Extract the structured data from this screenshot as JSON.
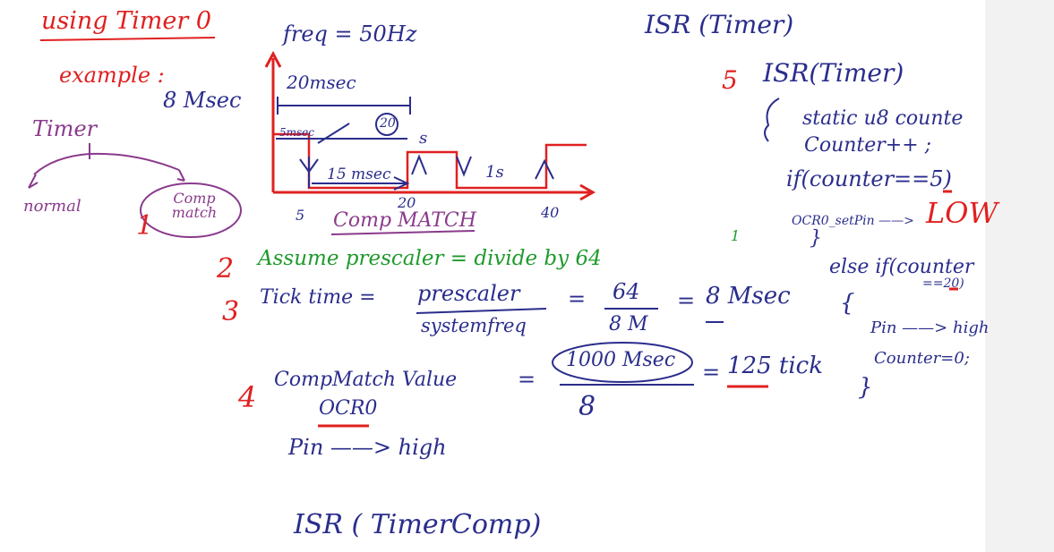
{
  "colors": {
    "red": "#e02020",
    "blue": "#2a2d8c",
    "purple": "#8a3a8c",
    "green": "#1f9a2c"
  },
  "left": {
    "title": "using Timer 0",
    "example": "example :",
    "msec": "8 Msec",
    "timer": "Timer",
    "normal": "normal",
    "comp_match": "Comp match",
    "num1": "1"
  },
  "diagram": {
    "freq": "freq = 50Hz",
    "period": "20msec",
    "low": "5msec",
    "high": "15 msec",
    "circled": "20",
    "s_label": "s",
    "one_s": "1s",
    "tick5": "5",
    "tick20": "20",
    "tick40": "40",
    "comp_match": "Comp MATCH"
  },
  "steps": {
    "n2": "2",
    "assume": "Assume prescaler = divide by 64",
    "n3": "3",
    "tick_time": "Tick time =",
    "prescaler": "prescaler",
    "systemfreq": "systemfreq",
    "eq1": "=",
    "num64": "64",
    "den8m": "8 M",
    "eq2": "=",
    "result8": "8 Msec",
    "n4": "4",
    "compmatch": "CompMatch Value",
    "ocr0": "OCR0",
    "eq3": "=",
    "usec1000": "1000 Msec",
    "den8": "8",
    "eq4": "=",
    "ticks": "125 tick",
    "pin_high": "Pin ——> high",
    "isr_comp": "ISR ( TimerComp)"
  },
  "isr": {
    "heading": "ISR (Timer)",
    "n5": "5",
    "fn": "ISR(Timer)",
    "brace_open": "{",
    "static": "static u8 counte",
    "incr": "Counter++ ;",
    "if": "if(counter==5)",
    "set": "OCR0_setPin ——>",
    "low": "LOW",
    "brace_close": "}",
    "else_if": "else if(counter",
    "eq20": "==20)",
    "brace2": "{",
    "pin_high": "Pin ——> high",
    "reset": "Counter=0;",
    "brace3": "}",
    "stray": "1"
  }
}
